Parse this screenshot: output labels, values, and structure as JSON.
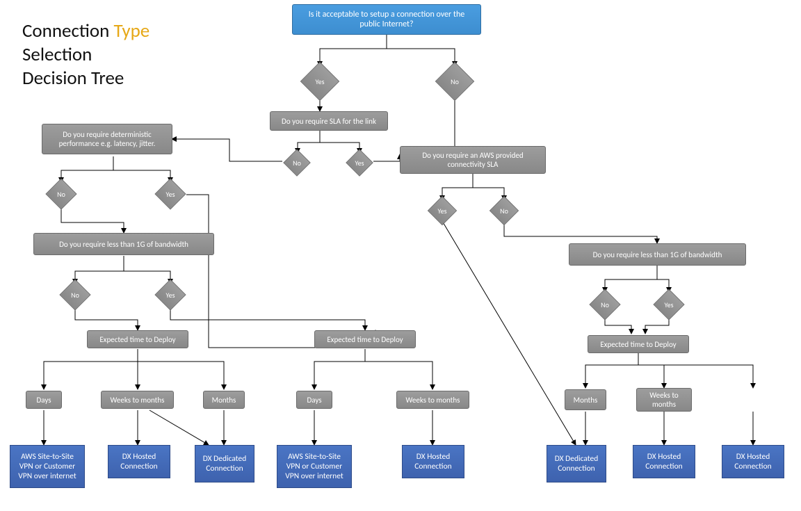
{
  "title": {
    "line1a": "Connection ",
    "line1b": "Type",
    "line2": "Selection",
    "line3": "Decision Tree"
  },
  "root": "Is it acceptable to setup a connection over the public Internet?",
  "yes": "Yes",
  "no": "No",
  "q_sla": "Do you require SLA for the link",
  "q_perf": "Do you require deterministic performance e.g. latency, jitter.",
  "q_aws_sla": "Do you require an AWS provided connectivity SLA",
  "q_bw": "Do you require less than 1G of bandwidth",
  "q_deploy": "Expected time to Deploy",
  "t_days": "Days",
  "t_weeks": "Weeks to months",
  "t_months": "Months",
  "r_vpn": "AWS Site-to-Site VPN or Customer VPN over internet",
  "r_hosted": "DX Hosted Connection",
  "r_dedicated": "DX Dedicated Connection"
}
